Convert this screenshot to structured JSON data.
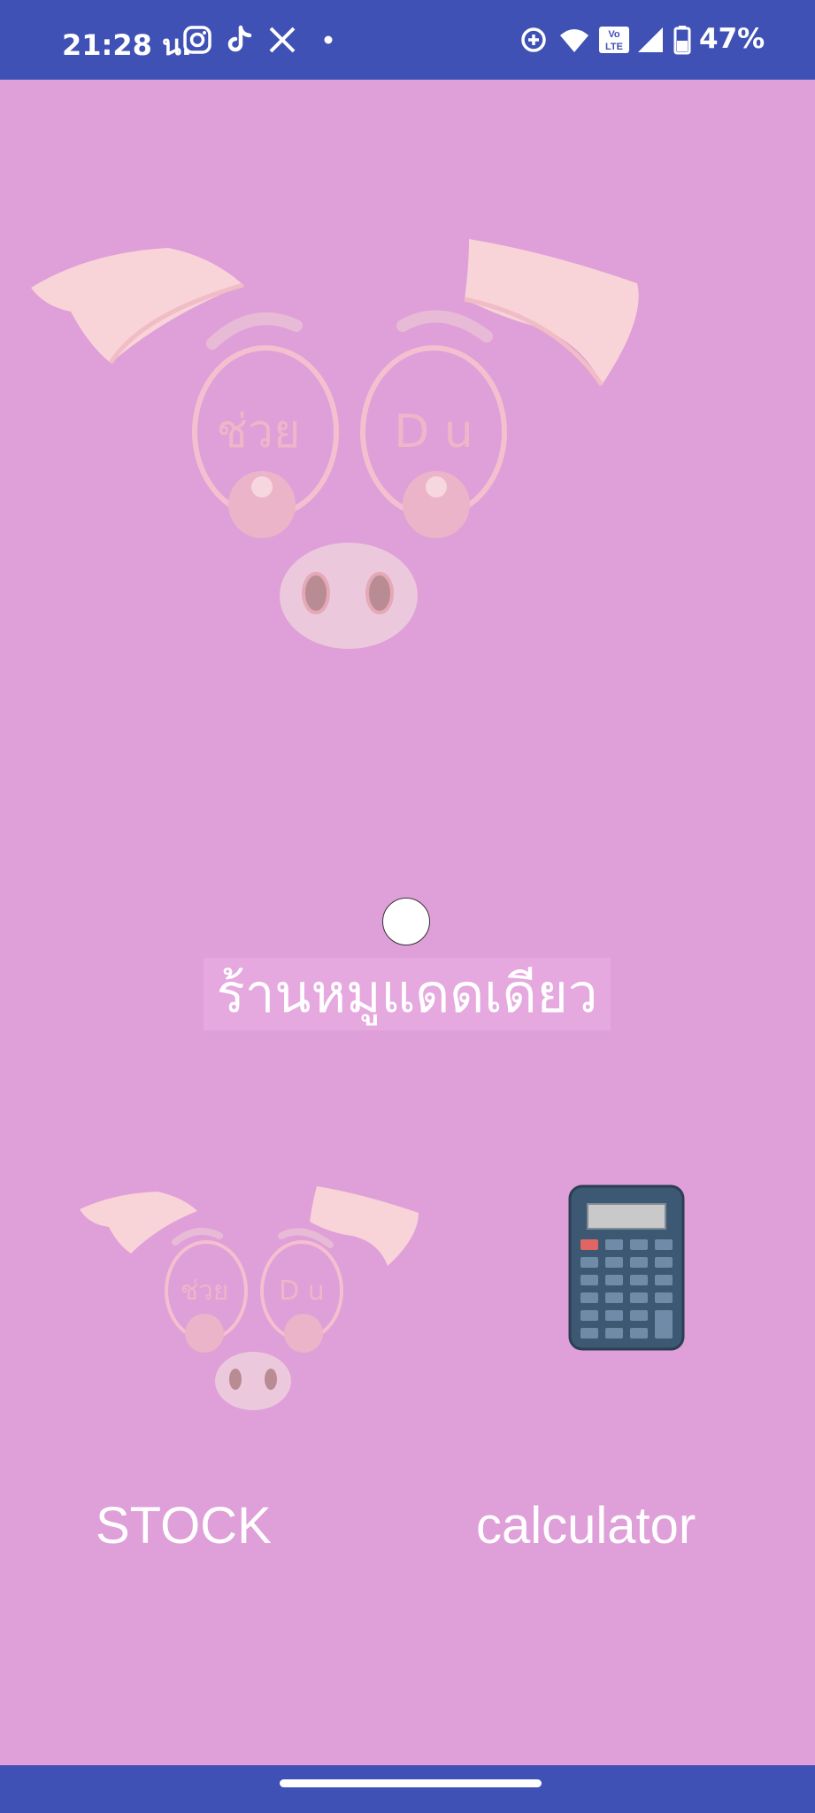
{
  "status_bar": {
    "time": "21:28 น.",
    "battery": "47%",
    "icons": [
      "instagram-icon",
      "tiktok-icon",
      "x-icon",
      "dot-icon",
      "data-saver-icon",
      "wifi-icon",
      "volte-icon",
      "signal-icon",
      "battery-icon"
    ]
  },
  "hero": {
    "logo": "pig-logo",
    "logo_text_left": "ช่วย",
    "logo_text_right": "D u"
  },
  "shop": {
    "title": "ร้านหมูแดดเดียว"
  },
  "menu": {
    "stock_label": "STOCK",
    "calculator_label": "calculator"
  }
}
